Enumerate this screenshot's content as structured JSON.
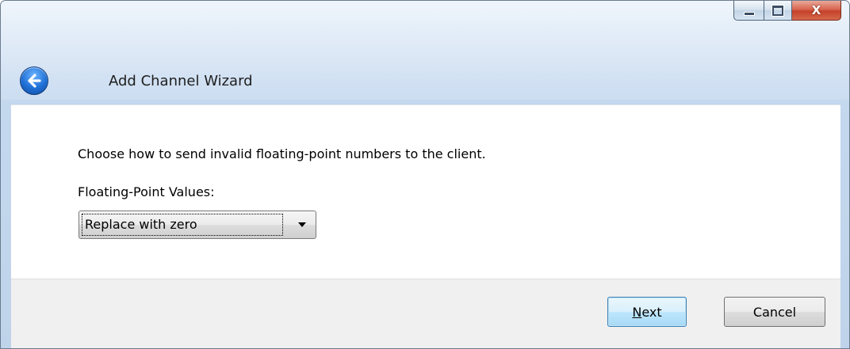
{
  "window": {
    "title": "Add Channel Wizard",
    "close_glyph": "X"
  },
  "icons": {
    "back": "back-arrow-icon",
    "minimize": "minimize-icon",
    "maximize": "maximize-icon",
    "close": "close-icon",
    "dropdown": "chevron-down-icon"
  },
  "content": {
    "instruction": "Choose how to send invalid floating-point numbers to the client.",
    "field_label": "Floating-Point Values:",
    "selected_value": "Replace with zero"
  },
  "buttons": {
    "next_accel": "N",
    "next_rest": "ext",
    "cancel": "Cancel"
  },
  "colors": {
    "accent": "#3c7fb1",
    "close_button": "#c4412a"
  }
}
